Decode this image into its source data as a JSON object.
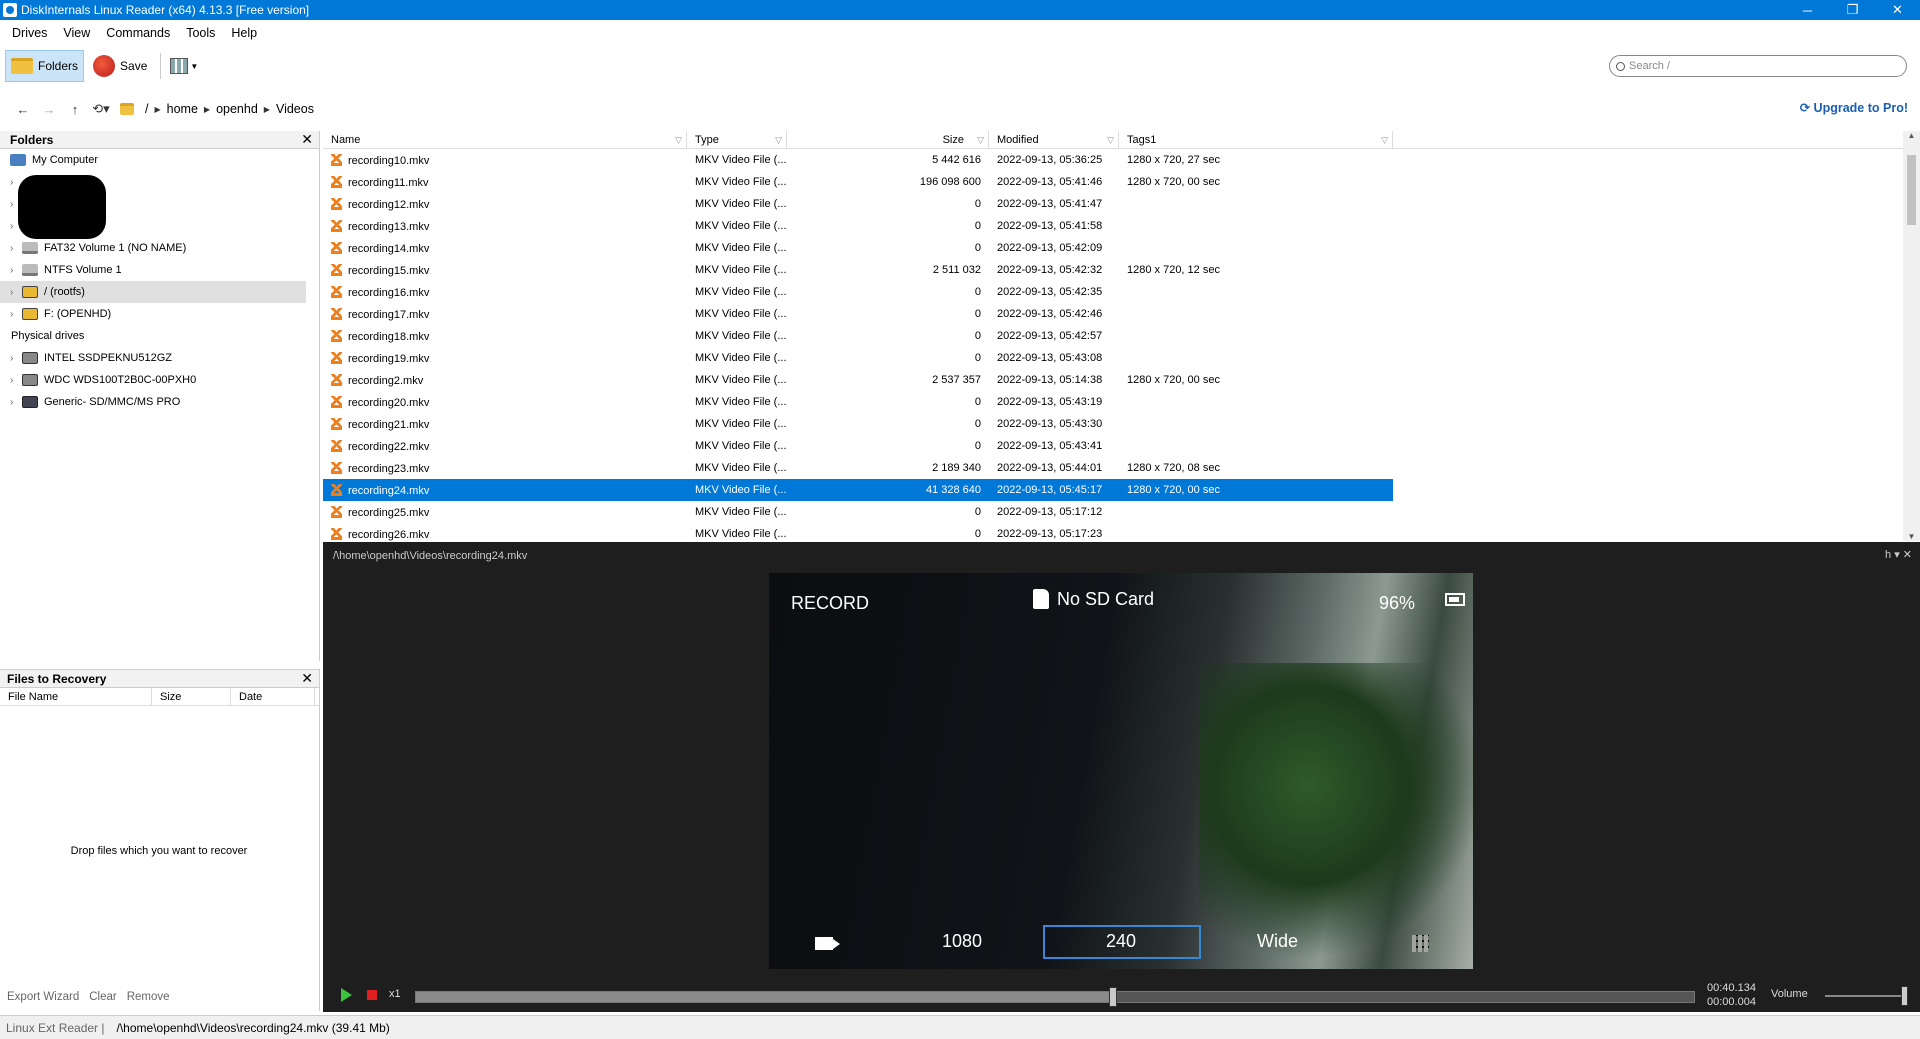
{
  "window": {
    "title": "DiskInternals Linux Reader (x64) 4.13.3 [Free version]",
    "controls": [
      "─",
      "❐",
      "✕"
    ]
  },
  "menu": [
    "Drives",
    "View",
    "Commands",
    "Tools",
    "Help"
  ],
  "toolbar": {
    "folders_label": "Folders",
    "save_label": "Save"
  },
  "search": {
    "placeholder": "Search /"
  },
  "address": {
    "root": "/",
    "crumbs": [
      "home",
      "openhd",
      "Videos"
    ]
  },
  "upgrade_label": "Upgrade to Pro!",
  "folders_panel": {
    "title": "Folders",
    "tree": [
      {
        "label": "My Computer",
        "icon": "computer-icon"
      },
      {
        "label": "FAT32 Volume 1 (NO NAME)",
        "icon": "volume-icon"
      },
      {
        "label": "NTFS Volume 1",
        "icon": "volume-icon"
      },
      {
        "label": "/ (rootfs)",
        "icon": "linux-volume-icon"
      },
      {
        "label": "F: (OPENHD)",
        "icon": "linux-volume-icon"
      }
    ],
    "physical_label": "Physical drives",
    "physical": [
      {
        "label": "INTEL SSDPEKNU512GZ"
      },
      {
        "label": "WDC WDS100T2B0C-00PXH0"
      },
      {
        "label": "Generic- SD/MMC/MS PRO"
      }
    ]
  },
  "recovery_panel": {
    "title": "Files to Recovery",
    "columns": [
      "File Name",
      "Size",
      "Date"
    ],
    "hint": "Drop files which you want to recover",
    "actions": [
      "Export Wizard",
      "Clear",
      "Remove"
    ]
  },
  "file_table": {
    "columns": [
      "Name",
      "Type",
      "Size",
      "Modified",
      "Tags1"
    ],
    "rows": [
      {
        "name": "recording10.mkv",
        "type": "MKV Video File (...",
        "size": "5 442 616",
        "modified": "2022-09-13, 05:36:25",
        "tags": "1280 x 720, 27 sec"
      },
      {
        "name": "recording11.mkv",
        "type": "MKV Video File (...",
        "size": "196 098 600",
        "modified": "2022-09-13, 05:41:46",
        "tags": "1280 x 720, 00 sec"
      },
      {
        "name": "recording12.mkv",
        "type": "MKV Video File (...",
        "size": "0",
        "modified": "2022-09-13, 05:41:47",
        "tags": ""
      },
      {
        "name": "recording13.mkv",
        "type": "MKV Video File (...",
        "size": "0",
        "modified": "2022-09-13, 05:41:58",
        "tags": ""
      },
      {
        "name": "recording14.mkv",
        "type": "MKV Video File (...",
        "size": "0",
        "modified": "2022-09-13, 05:42:09",
        "tags": ""
      },
      {
        "name": "recording15.mkv",
        "type": "MKV Video File (...",
        "size": "2 511 032",
        "modified": "2022-09-13, 05:42:32",
        "tags": "1280 x 720, 12 sec"
      },
      {
        "name": "recording16.mkv",
        "type": "MKV Video File (...",
        "size": "0",
        "modified": "2022-09-13, 05:42:35",
        "tags": ""
      },
      {
        "name": "recording17.mkv",
        "type": "MKV Video File (...",
        "size": "0",
        "modified": "2022-09-13, 05:42:46",
        "tags": ""
      },
      {
        "name": "recording18.mkv",
        "type": "MKV Video File (...",
        "size": "0",
        "modified": "2022-09-13, 05:42:57",
        "tags": ""
      },
      {
        "name": "recording19.mkv",
        "type": "MKV Video File (...",
        "size": "0",
        "modified": "2022-09-13, 05:43:08",
        "tags": ""
      },
      {
        "name": "recording2.mkv",
        "type": "MKV Video File (...",
        "size": "2 537 357",
        "modified": "2022-09-13, 05:14:38",
        "tags": "1280 x 720, 00 sec"
      },
      {
        "name": "recording20.mkv",
        "type": "MKV Video File (...",
        "size": "0",
        "modified": "2022-09-13, 05:43:19",
        "tags": ""
      },
      {
        "name": "recording21.mkv",
        "type": "MKV Video File (...",
        "size": "0",
        "modified": "2022-09-13, 05:43:30",
        "tags": ""
      },
      {
        "name": "recording22.mkv",
        "type": "MKV Video File (...",
        "size": "0",
        "modified": "2022-09-13, 05:43:41",
        "tags": ""
      },
      {
        "name": "recording23.mkv",
        "type": "MKV Video File (...",
        "size": "2 189 340",
        "modified": "2022-09-13, 05:44:01",
        "tags": "1280 x 720, 08 sec"
      },
      {
        "name": "recording24.mkv",
        "type": "MKV Video File (...",
        "size": "41 328 640",
        "modified": "2022-09-13, 05:45:17",
        "tags": "1280 x 720, 00 sec",
        "selected": true
      },
      {
        "name": "recording25.mkv",
        "type": "MKV Video File (...",
        "size": "0",
        "modified": "2022-09-13, 05:17:12",
        "tags": ""
      },
      {
        "name": "recording26.mkv",
        "type": "MKV Video File (...",
        "size": "0",
        "modified": "2022-09-13, 05:17:23",
        "tags": ""
      }
    ]
  },
  "preview": {
    "path": "/\\home\\openhd\\Videos\\recording24.mkv",
    "controls": "h ▾ ✕",
    "osd": {
      "record": "RECORD",
      "no_sd": "No SD Card",
      "battery": "96%",
      "resolution": "1080",
      "fps": "240",
      "fov": "Wide"
    },
    "player": {
      "speed": "x1",
      "time_current": "00:40.134",
      "time_remaining": "00:00.004",
      "volume_label": "Volume",
      "progress": 0.545,
      "volume": 1.0
    }
  },
  "status": {
    "mode": "Linux Ext Reader |",
    "path": "/\\home\\openhd\\Videos\\recording24.mkv (39.41 Mb)"
  },
  "colors": {
    "accent": "#0078d7",
    "link": "#1a5fb4",
    "preview_bg": "#1e1e1e"
  }
}
